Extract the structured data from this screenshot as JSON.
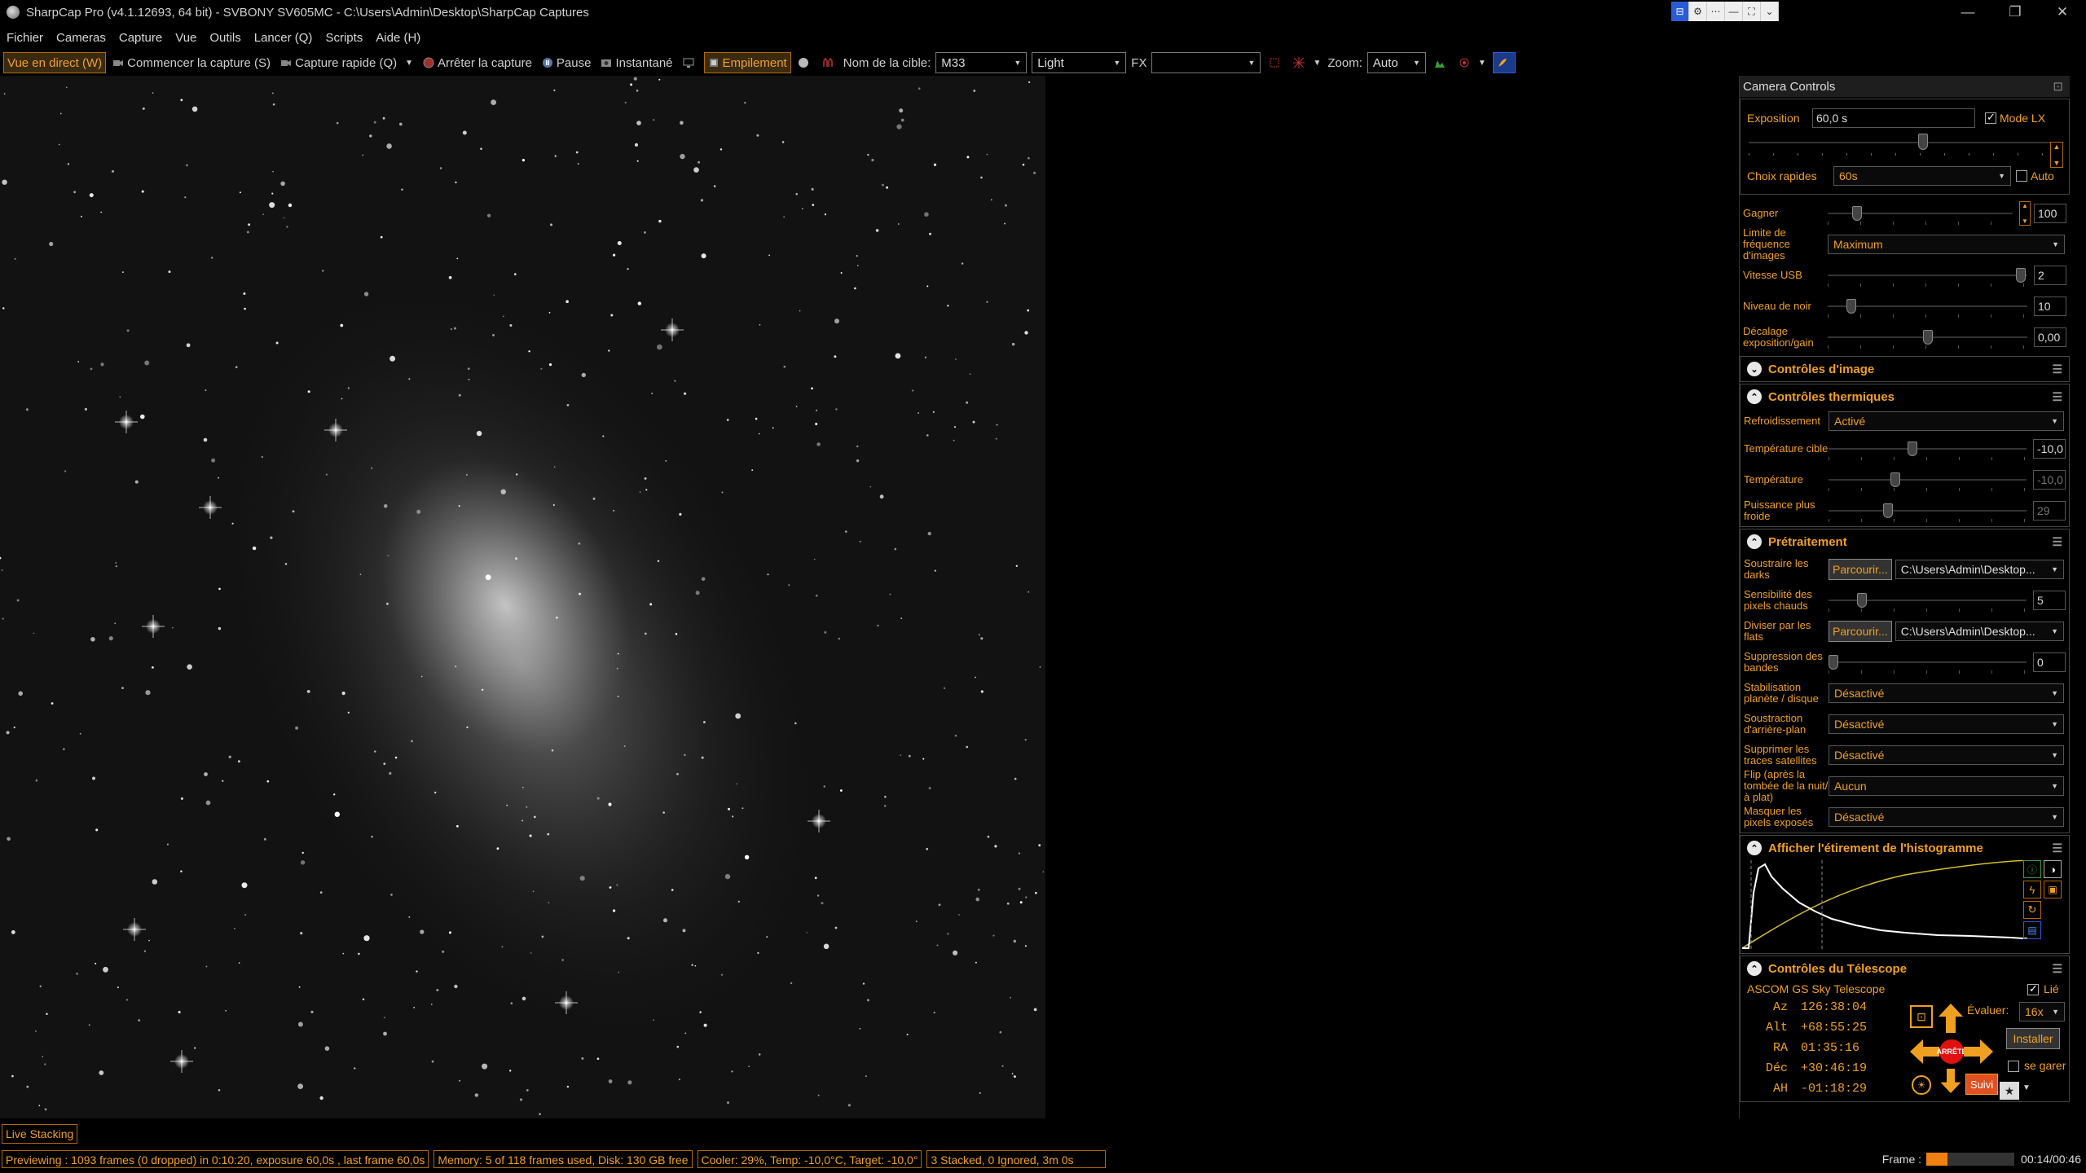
{
  "window": {
    "title": "SharpCap Pro (v4.1.12693, 64 bit) - SVBONY SV605MC - C:\\Users\\Admin\\Desktop\\SharpCap Captures",
    "minimize_glyph": "—",
    "restore_glyph": "❐",
    "close_glyph": "✕"
  },
  "mini_toolbar": {
    "items": [
      "⊟",
      "⚙",
      "⋯",
      "—",
      "⛶",
      "⌄"
    ]
  },
  "menu": [
    "Fichier",
    "Cameras",
    "Capture",
    "Vue",
    "Outils",
    "Lancer (Q)",
    "Scripts",
    "Aide (H)"
  ],
  "toolbar": {
    "live_view": "Vue en direct (W)",
    "start_capture": "Commencer la capture (S)",
    "quick_capture": "Capture rapide (Q)",
    "stop_capture": "Arrêter la capture",
    "pause": "Pause",
    "snapshot": "Instantané",
    "stacking": "Empilement",
    "target_label": "Nom de la cible:",
    "target_value": "M33",
    "frame_type": "Light",
    "fx_label": "FX",
    "fx_value": "",
    "zoom_label": "Zoom:",
    "zoom_value": "Auto"
  },
  "camera_controls": {
    "panel_title": "Camera Controls",
    "exposure_label": "Exposition",
    "exposure_value": "60,0 s",
    "lx_mode_label": "Mode LX",
    "lx_mode_checked": true,
    "quick_choices_label": "Choix rapides",
    "quick_choices_value": "60s",
    "auto_label": "Auto",
    "gain_label": "Gagner",
    "gain_value": "100",
    "gain_level": 0.14,
    "framerate_label": "Limite de fréquence d'images",
    "framerate_value": "Maximum",
    "usb_label": "Vitesse USB",
    "usb_value": "2",
    "usb_level": 0.99,
    "black_label": "Niveau de noir",
    "black_value": "10",
    "black_level": 0.1,
    "offset_label": "Décalage exposition/gain",
    "offset_value": "0,00",
    "offset_level": 0.5
  },
  "image_controls": {
    "title": "Contrôles d'image"
  },
  "thermal": {
    "title": "Contrôles thermiques",
    "cooling_label": "Refroidissement",
    "cooling_value": "Activé",
    "target_temp_label": "Température cible",
    "target_temp_value": "-10,0",
    "target_temp_level": 0.42,
    "temp_label": "Température",
    "temp_value": "-10,0",
    "temp_level": 0.33,
    "power_label": "Puissance plus froide",
    "power_value": "29",
    "power_level": 0.29
  },
  "preprocessing": {
    "title": "Prétraitement",
    "darks_label": "Soustraire les darks",
    "browse_label": "Parcourir...",
    "darks_path": "C:\\Users\\Admin\\Desktop...",
    "hotpix_label": "Sensibilité des pixels chauds",
    "hotpix_value": "5",
    "hotpix_level": 0.15,
    "flats_label": "Diviser par les flats",
    "flats_path": "C:\\Users\\Admin\\Desktop...",
    "banding_label": "Suppression des bandes",
    "banding_value": "0",
    "banding_level": 0.0,
    "stab_label": "Stabilisation planète / disque",
    "stab_value": "Désactivé",
    "bgsub_label": "Soustraction d'arrière-plan",
    "bgsub_value": "Désactivé",
    "sat_label": "Supprimer les traces satellites",
    "sat_value": "Désactivé",
    "flip_label": "Flip (après la tombée de la nuit/à plat)",
    "flip_value": "Aucun",
    "mask_label": "Masquer les pixels exposés",
    "mask_value": "Désactivé"
  },
  "histogram": {
    "title": "Afficher l'étirement de l'histogramme"
  },
  "telescope": {
    "title": "Contrôles du Télescope",
    "name": "ASCOM GS Sky Telescope",
    "linked_label": "Lié",
    "linked": true,
    "coords": [
      {
        "label": "Az",
        "value": "126:38:04"
      },
      {
        "label": "Alt",
        "value": "+68:55:25"
      },
      {
        "label": "RA",
        "value": "01:35:16"
      },
      {
        "label": "Déc",
        "value": "+30:46:19"
      },
      {
        "label": "AH",
        "value": "-01:18:29"
      }
    ],
    "stop_label": "ARRÊTE",
    "eval_label": "Évaluer:",
    "eval_value": "16x",
    "install_label": "Installer",
    "park_label": "se garer",
    "track_label": "Suivi"
  },
  "status": {
    "live_stacking": "Live Stacking",
    "previewing": "Previewing : 1093 frames (0 dropped) in 0:10:20, exposure 60,0s , last frame 60,0s",
    "memory": "Memory: 5 of 118 frames used, Disk: 130 GB free",
    "cooler": "Cooler: 29%, Temp: -10,0°C, Target: -10,0°",
    "stacked": "3 Stacked, 0 Ignored, 3m 0s",
    "frame_label": "Frame :",
    "frame_progress": 0.24,
    "time": "00:14/00:46"
  },
  "colors": {
    "accent": "#f0a020",
    "background": "#000000"
  }
}
